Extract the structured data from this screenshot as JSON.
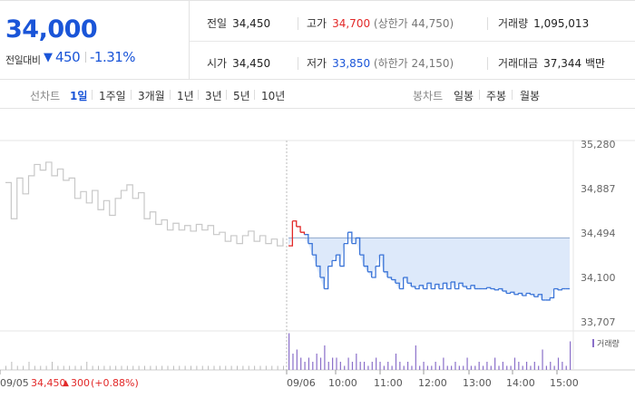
{
  "quote": {
    "price": "34,000",
    "change_label": "전일대비",
    "change_arrow": "▼",
    "change_value": "450",
    "change_rate": "-1.31%"
  },
  "info": {
    "prev_close": {
      "label": "전일",
      "value": "34,450"
    },
    "high": {
      "label": "고가",
      "value": "34,700",
      "sub": "(상한가 44,750)"
    },
    "volume": {
      "label": "거래량",
      "value": "1,095,013"
    },
    "open": {
      "label": "시가",
      "value": "34,450"
    },
    "low": {
      "label": "저가",
      "value": "33,850",
      "sub": "(하한가 24,150)"
    },
    "amount": {
      "label": "거래대금",
      "value": "37,344",
      "unit": "백만"
    }
  },
  "tabs": {
    "line_label": "선차트",
    "line_tabs": [
      "1일",
      "1주일",
      "3개월",
      "1년",
      "3년",
      "5년",
      "10년"
    ],
    "active": "1일",
    "candle_label": "봉차트",
    "candle_tabs": [
      "일봉",
      "주봉",
      "월봉"
    ]
  },
  "colors": {
    "up": "#e22828",
    "down": "#1a55d8",
    "prev_day": "#c8c8c8",
    "fill": "#dde9fa"
  },
  "chart_data": {
    "type": "line",
    "y_ticks": [
      "35,280",
      "34,887",
      "34,494",
      "34,100",
      "33,707"
    ],
    "ylim": [
      33707,
      35280
    ],
    "x_labels": [
      "09/05",
      "09/06",
      "10:00",
      "11:00",
      "12:00",
      "13:00",
      "14:00",
      "15:00"
    ],
    "prev_day_footer": {
      "date": "09/05",
      "price": "34,450",
      "arrow": "▲",
      "change": "300",
      "rate": "(+0.88%)"
    },
    "volume_legend": "거래량",
    "reference_price": 34450,
    "series": [
      {
        "values": [
          34940,
          34620,
          34980,
          34840,
          35000,
          35100,
          35050,
          35120,
          35000,
          35060,
          34960,
          34980,
          34800,
          34860,
          34760,
          34870,
          34700,
          34780,
          34650,
          34800,
          34870,
          34920,
          34800,
          34850,
          34620,
          34680,
          34570,
          34610,
          34520,
          34580,
          34520,
          34560,
          34510,
          34570,
          34520,
          34560,
          34480,
          34500,
          34420,
          34470,
          34400,
          34470,
          34510,
          34420,
          34470,
          34400,
          34440,
          34380,
          34450
        ]
      },
      {
        "values": [
          34380,
          34600,
          34550,
          34500,
          34480,
          34400,
          34300,
          34200,
          34100,
          34000,
          34200,
          34250,
          34300,
          34200,
          34400,
          34500,
          34400,
          34450,
          34300,
          34200,
          34150,
          34100,
          34200,
          34300,
          34150,
          34100,
          34080,
          34050,
          34000,
          34100,
          34050,
          34020,
          34000,
          34030,
          34000,
          34050,
          34000,
          34040,
          34000,
          34050,
          34000,
          34060,
          34000,
          34050,
          34020,
          34000,
          34030,
          34000,
          34000,
          34000,
          34010,
          34000,
          33990,
          34000,
          33980,
          33960,
          33970,
          33950,
          33960,
          33940,
          33960,
          33950,
          33930,
          33950,
          33900,
          33900,
          33920,
          34000,
          33990,
          34000,
          34000,
          34000
        ]
      }
    ],
    "volume_series": [
      {
        "values": [
          1,
          2,
          1,
          1,
          2,
          1,
          1,
          1,
          2,
          1,
          1,
          1,
          1,
          1,
          2,
          1,
          1,
          1,
          1,
          1,
          1,
          1,
          1,
          1,
          1,
          1,
          1,
          1,
          1,
          1,
          1,
          1,
          1,
          1,
          1,
          1,
          1,
          1,
          1,
          1,
          1,
          1,
          1,
          1,
          1,
          1,
          1,
          1,
          1
        ]
      },
      {
        "values": [
          9,
          4,
          5,
          3,
          2,
          3,
          2,
          4,
          3,
          6,
          2,
          3,
          3,
          2,
          1,
          3,
          2,
          4,
          2,
          2,
          1,
          2,
          3,
          2,
          1,
          2,
          1,
          4,
          2,
          1,
          2,
          1,
          6,
          1,
          2,
          1,
          1,
          2,
          1,
          3,
          1,
          1,
          2,
          1,
          1,
          3,
          1,
          1,
          2,
          1,
          2,
          1,
          3,
          1,
          2,
          1,
          1,
          3,
          2,
          1,
          2,
          1,
          2,
          1,
          5,
          1,
          2,
          1,
          3,
          2,
          1,
          7
        ]
      }
    ]
  }
}
